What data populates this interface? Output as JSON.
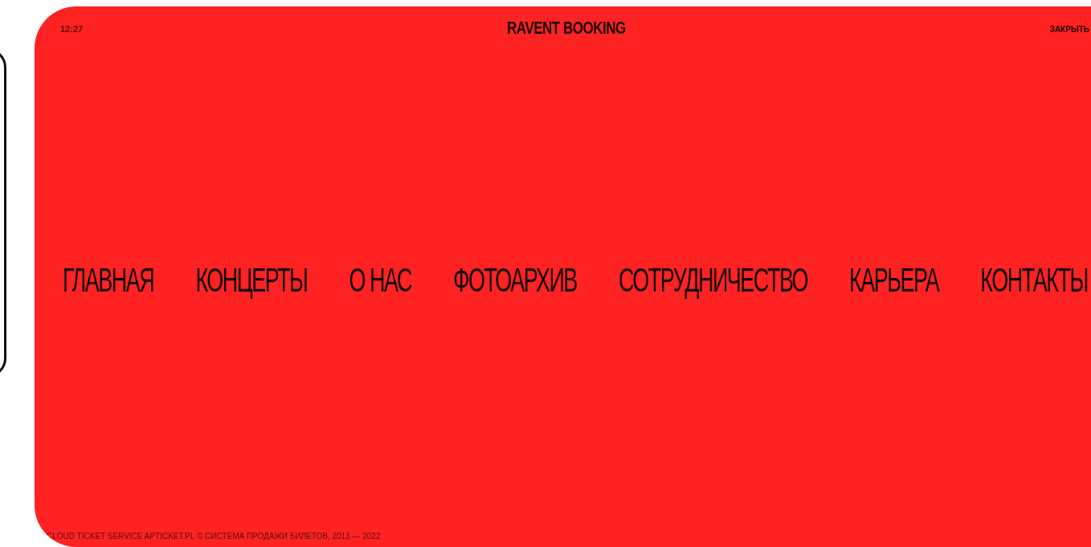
{
  "header": {
    "time": "12:27",
    "title": "RAVENT BOOKING",
    "close": "ЗАКРЫТЬ"
  },
  "menu": [
    {
      "label": "ГЛАВНАЯ"
    },
    {
      "label": "КОНЦЕРТЫ"
    },
    {
      "label": "О НАС"
    },
    {
      "label": "ФОТОАРХИВ"
    },
    {
      "label": "СОТРУДНИЧЕСТВО"
    },
    {
      "label": "КАРЬЕРА"
    },
    {
      "label": "КОНТАКТЫ"
    }
  ],
  "footer": "CLOUD TICKET SERVICE APTICKET.PL © СИСТЕМА ПРОДАЖИ БИЛЕТОВ, 2013 — 2022"
}
